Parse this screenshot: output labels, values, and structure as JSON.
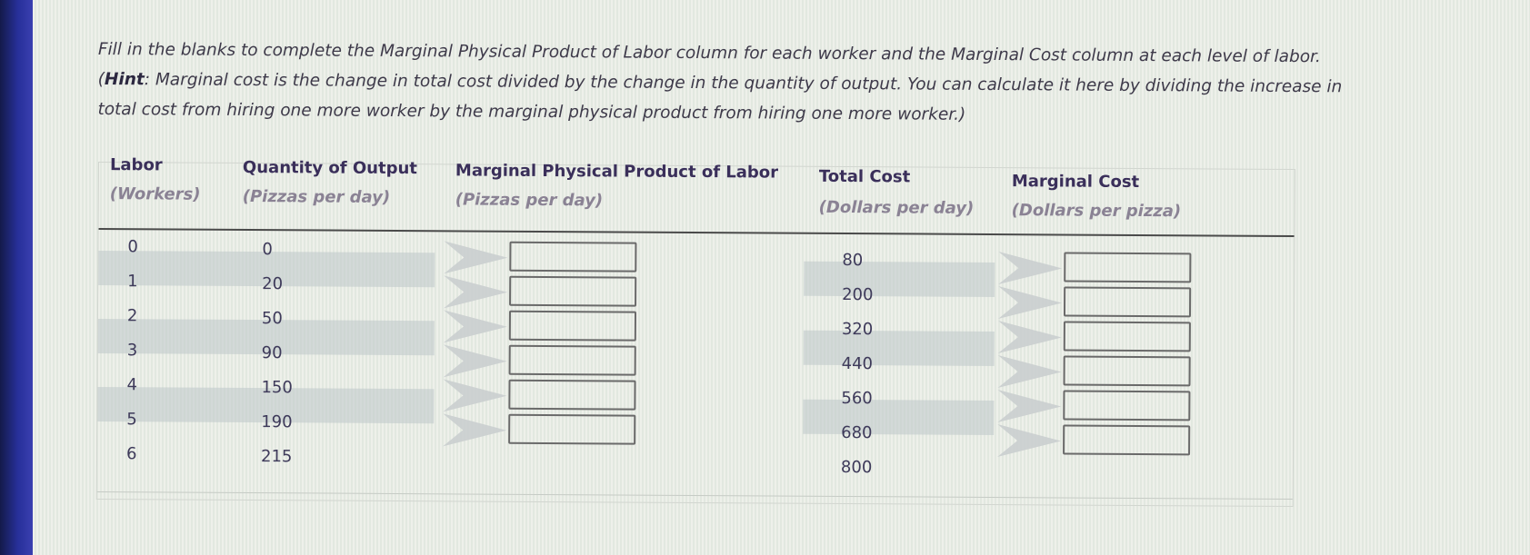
{
  "instructions": {
    "line1": "Fill in the blanks to complete the Marginal Physical Product of Labor column for each worker and the Marginal Cost column at each level of labor.",
    "hint_label": "Hint",
    "line2_rest": ": Marginal cost is the change in total cost divided by the change in the quantity of output. You can calculate it here by dividing the increase in",
    "line3": "total cost from hiring one more worker by the marginal physical product from hiring one more worker.)"
  },
  "table": {
    "columns": [
      {
        "title": "Labor",
        "unit": "(Workers)"
      },
      {
        "title": "Quantity of Output",
        "unit": "(Pizzas per day)"
      },
      {
        "title": "Marginal Physical Product of Labor",
        "unit": "(Pizzas per day)"
      },
      {
        "title": "Total Cost",
        "unit": "(Dollars per day)"
      },
      {
        "title": "Marginal Cost",
        "unit": "(Dollars per pizza)"
      }
    ],
    "rows": [
      {
        "labor": "0",
        "output": "0",
        "total_cost": "80"
      },
      {
        "labor": "1",
        "output": "20",
        "total_cost": "200"
      },
      {
        "labor": "2",
        "output": "50",
        "total_cost": "320"
      },
      {
        "labor": "3",
        "output": "90",
        "total_cost": "440"
      },
      {
        "labor": "4",
        "output": "150",
        "total_cost": "560"
      },
      {
        "labor": "5",
        "output": "190",
        "total_cost": "680"
      },
      {
        "labor": "6",
        "output": "215",
        "total_cost": "800"
      }
    ],
    "mpl_inputs": [
      "",
      "",
      "",
      "",
      "",
      ""
    ],
    "mc_inputs": [
      "",
      "",
      "",
      "",
      "",
      ""
    ]
  },
  "colors": {
    "stripe": "#bec6c8",
    "header_text": "#3a2f5a",
    "unit_text": "#8a8294",
    "screen_bg": "#e9ece6",
    "bezel": "#27309a"
  }
}
